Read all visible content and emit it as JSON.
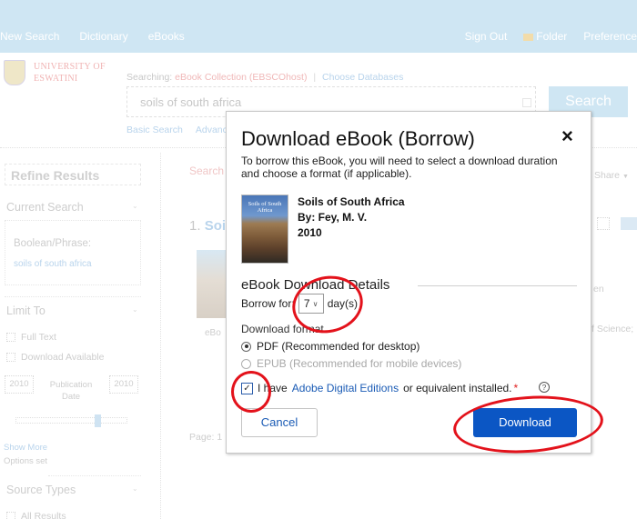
{
  "topbar": {
    "nav_left": [
      "New Search",
      "Dictionary",
      "eBooks"
    ],
    "sign_out": "Sign Out",
    "folder": "Folder",
    "preferences": "Preferences"
  },
  "brand": {
    "logo_line1": "UNIVERSITY OF",
    "logo_line2": "ESWATINI"
  },
  "search": {
    "searching_prefix": "Searching:",
    "database": "eBook Collection (EBSCOhost)",
    "choose_databases": "Choose Databases",
    "query": "soils of south africa",
    "search_button": "Search",
    "basic_search": "Basic Search",
    "advanced_search": "Advanced Search"
  },
  "sidebar": {
    "refine_results": "Refine Results",
    "current_search": "Current Search",
    "boolean_phrase_label": "Boolean/Phrase:",
    "boolean_phrase_value": "soils of south africa",
    "limit_to": "Limit To",
    "full_text": "Full Text",
    "download_available": "Download Available",
    "pub_date_from": "2010",
    "pub_date_to": "2010",
    "publication_date_label": "Publication Date",
    "show_more": "Show More",
    "options_set": "Options set",
    "source_types": "Source Types",
    "all_results": "All Results"
  },
  "results": {
    "search_label": "Search",
    "result_number": "1.",
    "result_title_fragment": "Soi",
    "ebook_label": "eBo",
    "page_label": "Page: 1",
    "share": "Share",
    "right_text1": "en",
    "right_text2": "f Science;"
  },
  "modal": {
    "title": "Download eBook (Borrow)",
    "close_icon": "×",
    "intro": "To borrow this eBook, you will need to select a download duration and choose a format (if applicable).",
    "book": {
      "cover_title": "Soils of South Africa",
      "title": "Soils of South Africa",
      "author": "By: Fey, M. V.",
      "year": "2010"
    },
    "details_heading": "eBook Download Details",
    "borrow_for_label": "Borrow for:",
    "borrow_days_value": "7",
    "borrow_days_suffix": "day(s)",
    "download_format_label": "Download format",
    "formats": [
      {
        "label": "PDF (Recommended for desktop)",
        "selected": true,
        "enabled": true
      },
      {
        "label": "EPUB (Recommended for mobile devices)",
        "selected": false,
        "enabled": false
      }
    ],
    "agree_prefix": "I have",
    "agree_link": "Adobe Digital Editions",
    "agree_suffix": "or equivalent installed.",
    "agree_required_mark": "*",
    "agree_checked": true,
    "help_icon": "?",
    "cancel_button": "Cancel",
    "download_button": "Download"
  },
  "colors": {
    "primary_button": "#0b56c4",
    "link": "#1a5bb5",
    "annotation": "#e3121b",
    "topbar_faded": "#cfe6f3"
  }
}
